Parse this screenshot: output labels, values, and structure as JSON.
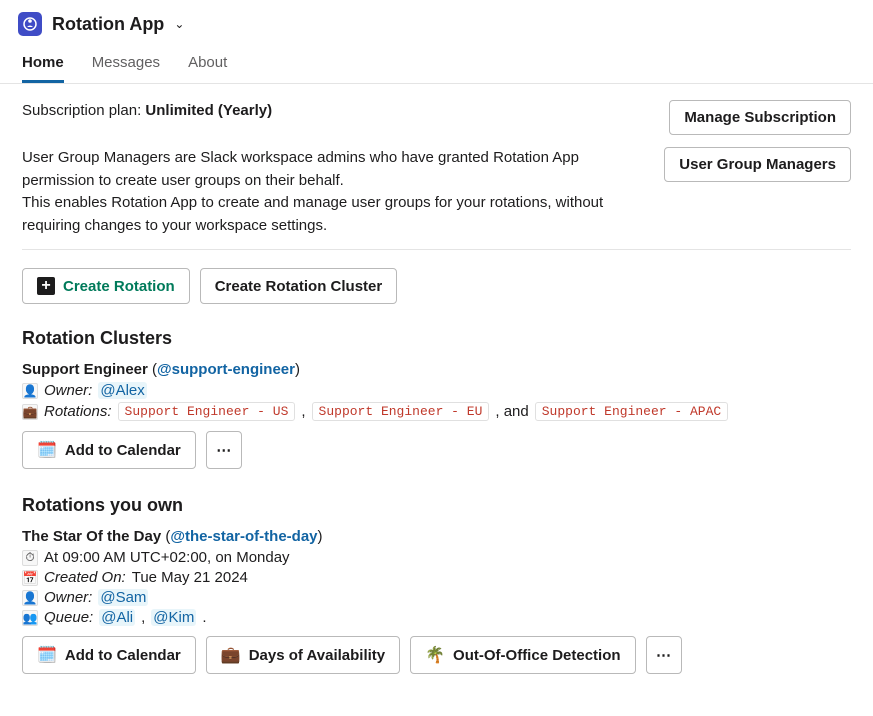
{
  "header": {
    "app_name": "Rotation App"
  },
  "tabs": {
    "home": "Home",
    "messages": "Messages",
    "about": "About"
  },
  "subscription": {
    "label": "Subscription plan: ",
    "plan": "Unlimited (Yearly)",
    "manage_btn": "Manage Subscription"
  },
  "ugm": {
    "text_line1": "User Group Managers are Slack workspace admins who have granted Rotation App permission to create user groups on their behalf.",
    "text_line2": "This enables Rotation App to create and manage user groups for your rotations, without requiring changes to your workspace settings.",
    "btn": "User Group Managers"
  },
  "main_actions": {
    "create_rotation": "Create Rotation",
    "create_cluster": "Create Rotation Cluster"
  },
  "clusters": {
    "heading": "Rotation Clusters",
    "items": [
      {
        "name": "Support Engineer",
        "handle": "@support-engineer",
        "owner_label": "Owner:",
        "owner": "@Alex",
        "rotations_label": "Rotations:",
        "rotations": [
          "Support Engineer - US",
          "Support Engineer - EU",
          "Support Engineer - APAC"
        ],
        "joiner_comma": ", ",
        "joiner_and": ", and ",
        "add_calendar": "Add to Calendar"
      }
    ]
  },
  "owned": {
    "heading": "Rotations you own",
    "items": [
      {
        "name": "The Star Of the Day",
        "handle": "@the-star-of-the-day",
        "schedule": "At 09:00 AM UTC+02:00, on Monday",
        "created_label": "Created On:",
        "created": "Tue May 21 2024",
        "owner_label": "Owner:",
        "owner": "@Sam",
        "queue_label": "Queue:",
        "queue": [
          "@Ali",
          "@Kim"
        ],
        "queue_sep": ", ",
        "queue_end": ".",
        "add_calendar": "Add to Calendar",
        "availability": "Days of Availability",
        "ooo": "Out-Of-Office Detection"
      }
    ]
  },
  "glyphs": {
    "more": "⋯"
  }
}
